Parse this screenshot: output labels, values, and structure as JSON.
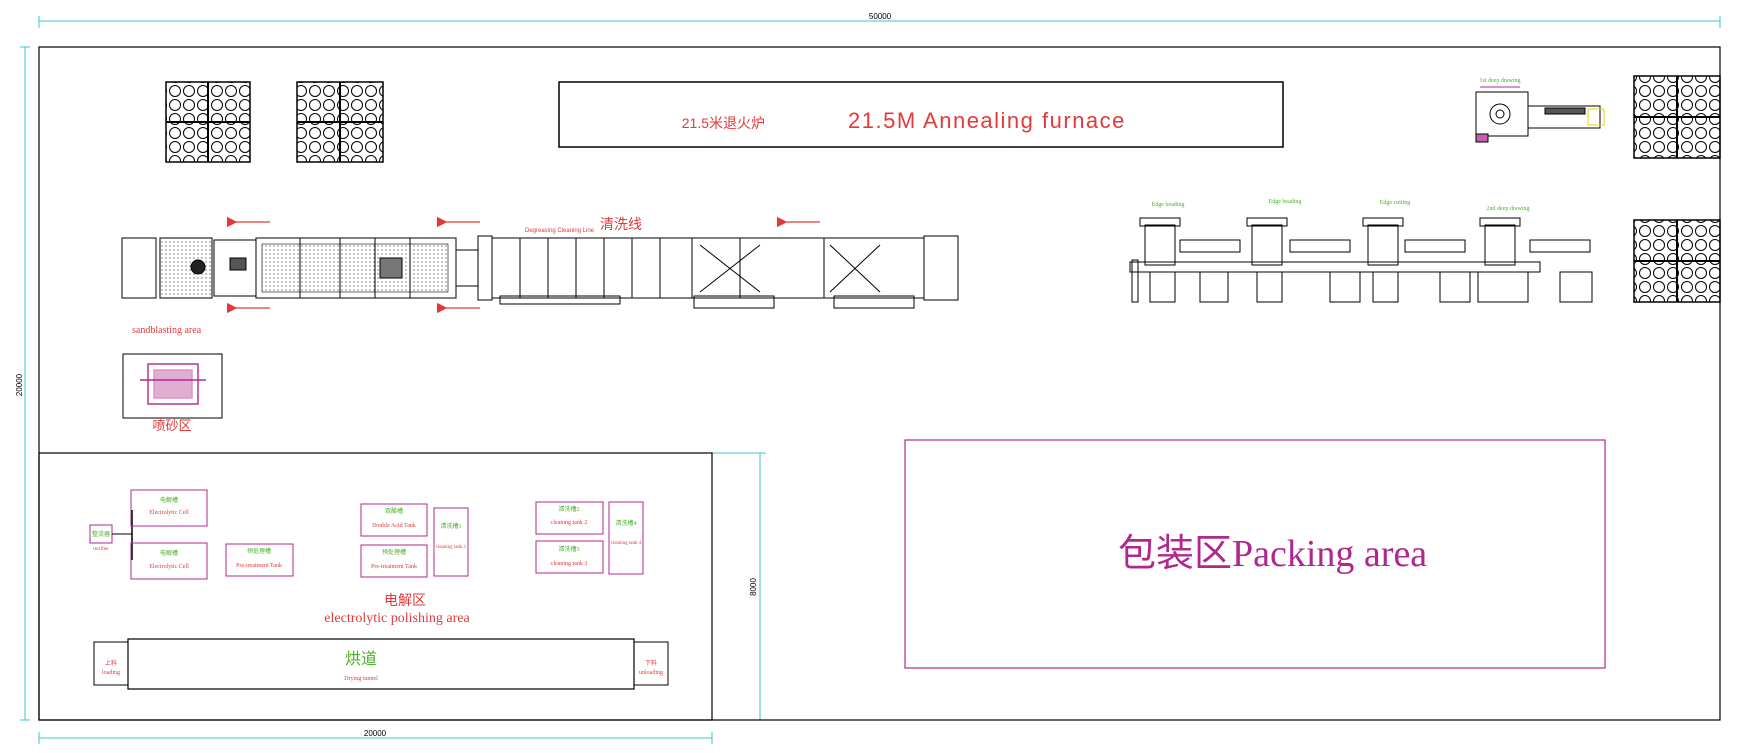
{
  "dimensions": {
    "overall_width": "50000",
    "overall_height": "20000",
    "ep_width": "20000",
    "ep_height": "8000"
  },
  "furnace": {
    "cn": "21.5米退火炉",
    "en": "21.5M Annealing furnace"
  },
  "cleaning_line": {
    "cn": "清洗线",
    "en": "Degreasing Cleaning Line"
  },
  "sandblasting": {
    "en_label": "sandblasting area",
    "cn_label": "喷砂区"
  },
  "forming_line": {
    "labels": [
      "Edge beading",
      "Edge beading",
      "Edge cutting",
      "2nd deep drawing"
    ],
    "top_label": "1st deep drawing"
  },
  "ep_area": {
    "cn": "电解区",
    "en": "electrolytic polishing area",
    "rectifier": {
      "cn": "整流器",
      "en": "rectifier"
    },
    "cells": [
      {
        "cn": "电解槽",
        "en": "Electrolytic Cell"
      },
      {
        "cn": "电解槽",
        "en": "Electrolytic Cell"
      }
    ],
    "pretreat_tank": {
      "cn": "预处理槽",
      "en": "Pre-treatment Tank"
    },
    "double_acid_tank": {
      "cn": "双酸槽",
      "en": "Double Acid Tank"
    },
    "pretreat_tank_2": {
      "cn": "预处理槽",
      "en": "Pre-treatment Tank"
    },
    "cleaning_tank_1": {
      "cn": "清洗槽1",
      "en": "cleaning tank 1"
    },
    "cleaning_tank_2a": {
      "cn": "清洗槽2",
      "en": "cleaning tank 2"
    },
    "cleaning_tank_3": {
      "cn": "清洗槽3",
      "en": "cleaning tank 3"
    },
    "cleaning_tank_4": {
      "cn": "清洗槽4",
      "en": "cleaning tank 4"
    }
  },
  "drying": {
    "cn": "烘道",
    "en": "Drying tunnel",
    "loading": {
      "cn": "上料",
      "en": "loading"
    },
    "unloading": {
      "cn": "下料",
      "en": "unloading"
    }
  },
  "packing": {
    "label": "包装区Packing area"
  },
  "colors": {
    "red": "#e23a3a",
    "green": "#4caf2a",
    "magenta": "#b0288f",
    "cyan": "#3fc3d6",
    "line": "#000000"
  }
}
